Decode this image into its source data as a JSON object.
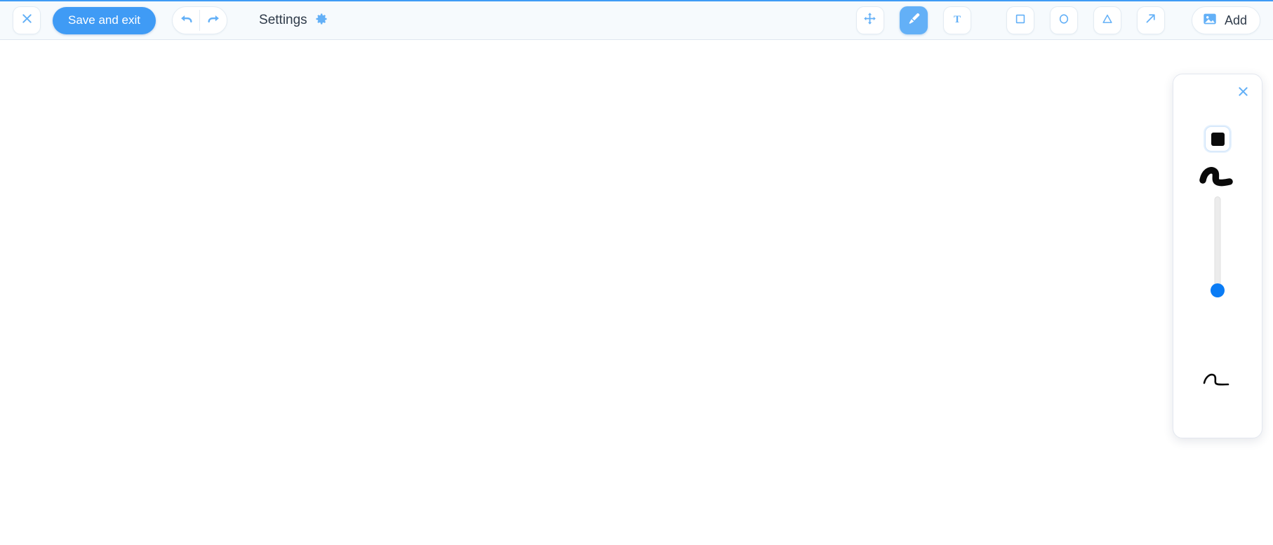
{
  "toolbar": {
    "close_icon": "close-icon",
    "save_exit_label": "Save and exit",
    "undo_icon": "undo-arrow-icon",
    "redo_icon": "redo-arrow-icon",
    "settings_label": "Settings",
    "settings_icon": "gear-icon",
    "tools": [
      {
        "name": "move",
        "icon": "move-arrows-icon",
        "active": false
      },
      {
        "name": "brush",
        "icon": "paintbrush-icon",
        "active": true
      },
      {
        "name": "text",
        "icon": "text-t-icon",
        "active": false
      },
      {
        "name": "rectangle",
        "icon": "square-icon",
        "active": false
      },
      {
        "name": "ellipse",
        "icon": "circle-icon",
        "active": false
      },
      {
        "name": "triangle",
        "icon": "triangle-icon",
        "active": false
      },
      {
        "name": "arrow",
        "icon": "diagonal-arrow-icon",
        "active": false
      }
    ],
    "add_label": "Add",
    "add_icon": "image-icon"
  },
  "brush_panel": {
    "close_icon": "close-icon",
    "color_swatch_name": "color-swatch",
    "color_value": "#0a0a0a",
    "stroke_preview_max_label": "thick-stroke-preview",
    "stroke_preview_min_label": "thin-stroke-preview",
    "slider": {
      "name": "brush-size-slider",
      "orientation": "vertical",
      "value_percent": 7,
      "thumb_color": "#0a7cf5",
      "track_color": "#ececec"
    }
  },
  "colors": {
    "accent": "#3f9bf5",
    "accent_light": "#63b0f7",
    "toolbar_bg": "#f6fafd",
    "panel_bg": "#ffffff",
    "canvas_bg": "#ffffff",
    "slider_blue": "#0a7cf5"
  }
}
